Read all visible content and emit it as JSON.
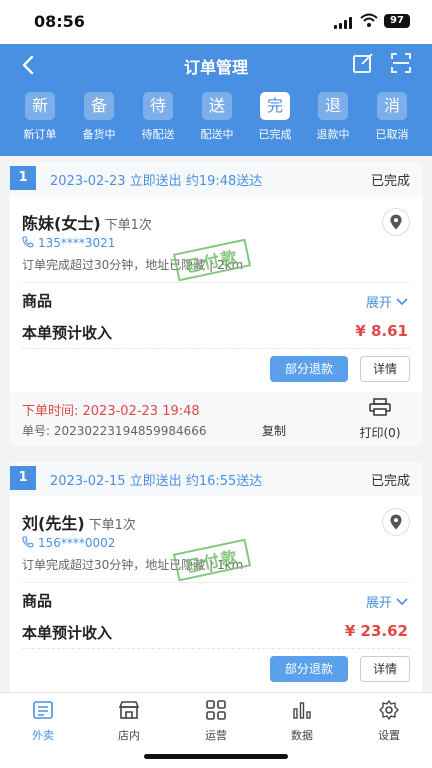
{
  "status_bar": {
    "time": "08:56",
    "battery": "97"
  },
  "header": {
    "title": "订单管理"
  },
  "tabs": [
    {
      "icon_char": "新",
      "label": "新订单"
    },
    {
      "icon_char": "备",
      "label": "备货中"
    },
    {
      "icon_char": "待",
      "label": "待配送"
    },
    {
      "icon_char": "送",
      "label": "配送中"
    },
    {
      "icon_char": "完",
      "label": "已完成"
    },
    {
      "icon_char": "退",
      "label": "退款中"
    },
    {
      "icon_char": "消",
      "label": "已取消"
    }
  ],
  "active_tab": "已完成",
  "orders": [
    {
      "index": "1",
      "header_info": "2023-02-23 立即送出 约19:48送达",
      "status": "已完成",
      "customer": "陈妹(女士)",
      "order_count": "下单1次",
      "phone": "135****3021",
      "note": "订单完成超过30分钟，地址已隐藏  |  2km",
      "stamp": "已付款",
      "goods_label": "商品",
      "expand_label": "展开",
      "income_label": "本单预计收入",
      "income_amount": "¥ 8.61",
      "refund_button": "部分退款",
      "detail_button": "详情",
      "order_time": "下单时间:  2023-02-23 19:48",
      "order_no": "单号:  20230223194859984666",
      "copy_label": "复制",
      "print_label": "打印(0)"
    },
    {
      "index": "1",
      "header_info": "2023-02-15 立即送出 约16:55送达",
      "status": "已完成",
      "customer": "刘(先生)",
      "order_count": "下单1次",
      "phone": "156****0002",
      "note": "订单完成超过30分钟，地址已隐藏  |  1km",
      "stamp": "已付款",
      "goods_label": "商品",
      "expand_label": "展开",
      "income_label": "本单预计收入",
      "income_amount": "¥ 23.62",
      "refund_button": "部分退款",
      "detail_button": "详情"
    }
  ],
  "bottom_nav": [
    {
      "label": "外卖",
      "icon": "takeout-icon"
    },
    {
      "label": "店内",
      "icon": "store-icon"
    },
    {
      "label": "运营",
      "icon": "grid-icon"
    },
    {
      "label": "数据",
      "icon": "bar-chart-icon"
    },
    {
      "label": "设置",
      "icon": "gear-icon"
    }
  ],
  "colors": {
    "primary": "#4a90e2",
    "price": "#e04848",
    "stamp": "#6fbf6a"
  }
}
